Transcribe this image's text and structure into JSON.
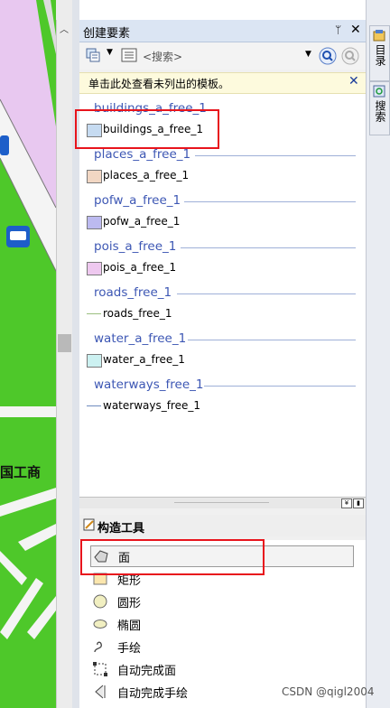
{
  "map": {
    "label": "国工商"
  },
  "panel": {
    "title": "创建要素",
    "pin_glyph": "ᛘ",
    "close_glyph": "✕",
    "search_placeholder": "<搜索>",
    "hint": "单击此处查看未列出的模板。",
    "hint_close": "✕"
  },
  "templates": [
    {
      "group": "buildings_a_free_1",
      "item": "buildings_a_free_1",
      "kind": "fill",
      "color": "#c6dbf1"
    },
    {
      "group": "places_a_free_1",
      "item": "places_a_free_1",
      "kind": "fill",
      "color": "#f2d7c3"
    },
    {
      "group": "pofw_a_free_1",
      "item": "pofw_a_free_1",
      "kind": "fill",
      "color": "#bcbaf0"
    },
    {
      "group": "pois_a_free_1",
      "item": "pois_a_free_1",
      "kind": "fill",
      "color": "#eec8ef"
    },
    {
      "group": "roads_free_1",
      "item": "roads_free_1",
      "kind": "line",
      "color": "#9bbf7f"
    },
    {
      "group": "water_a_free_1",
      "item": "water_a_free_1",
      "kind": "fill",
      "color": "#ccf1f1"
    },
    {
      "group": "waterways_free_1",
      "item": "waterways_free_1",
      "kind": "line",
      "color": "#6f8bbf"
    }
  ],
  "construction": {
    "title": "构造工具",
    "tools": [
      {
        "label": "面",
        "icon": "polygon-icon"
      },
      {
        "label": "矩形",
        "icon": "rectangle-icon"
      },
      {
        "label": "圆形",
        "icon": "circle-icon"
      },
      {
        "label": "椭圆",
        "icon": "ellipse-icon"
      },
      {
        "label": "手绘",
        "icon": "freehand-icon"
      },
      {
        "label": "自动完成面",
        "icon": "auto-complete-polygon-icon"
      },
      {
        "label": "自动完成手绘",
        "icon": "auto-complete-freehand-icon"
      }
    ]
  },
  "side_tabs": {
    "catalog": "目录",
    "search": "搜索"
  },
  "watermark": "CSDN @qigl2004",
  "colors": {
    "map_green": "#4ec82a",
    "map_pink": "#e8c8f0",
    "group_blue": "#3d57b4",
    "highlight_red": "#e8141c"
  }
}
